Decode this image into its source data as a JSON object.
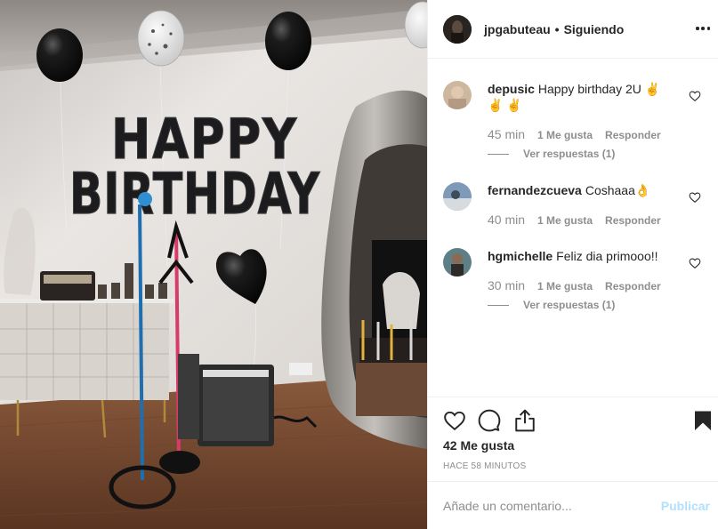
{
  "post": {
    "author": "jpgabuteau",
    "separator": "•",
    "follow_status": "Siguiendo",
    "likes_text": "42 Me gusta",
    "time_ago": "HACE 58 MINUTOS"
  },
  "photo": {
    "letters_row1": [
      "H",
      "A",
      "P",
      "P",
      "Y"
    ],
    "letters_row2": [
      "B",
      "I",
      "R",
      "T",
      "H",
      "D",
      "A",
      "Y"
    ],
    "balloon_color": "#151515",
    "wall_color": "#e7e4e1",
    "floor_color": "#8a5a3c"
  },
  "comments": [
    {
      "user": "depusic",
      "text": "Happy birthday 2U ✌✌ ✌",
      "time": "45 min",
      "likes": "1 Me gusta",
      "reply": "Responder",
      "replies": "Ver respuestas (1)"
    },
    {
      "user": "fernandezcueva",
      "text": "Coshaaa👌",
      "time": "40 min",
      "likes": "1 Me gusta",
      "reply": "Responder"
    },
    {
      "user": "hgmichelle",
      "text": "Feliz dia primooo!!",
      "time": "30 min",
      "likes": "1 Me gusta",
      "reply": "Responder",
      "replies": "Ver respuestas (1)"
    }
  ],
  "icons": {
    "like": "heart-icon",
    "comment": "comment-icon",
    "share": "share-icon",
    "save": "bookmark-icon",
    "more": "more-icon"
  },
  "composer": {
    "placeholder": "Añade un comentario...",
    "publish": "Publicar"
  }
}
